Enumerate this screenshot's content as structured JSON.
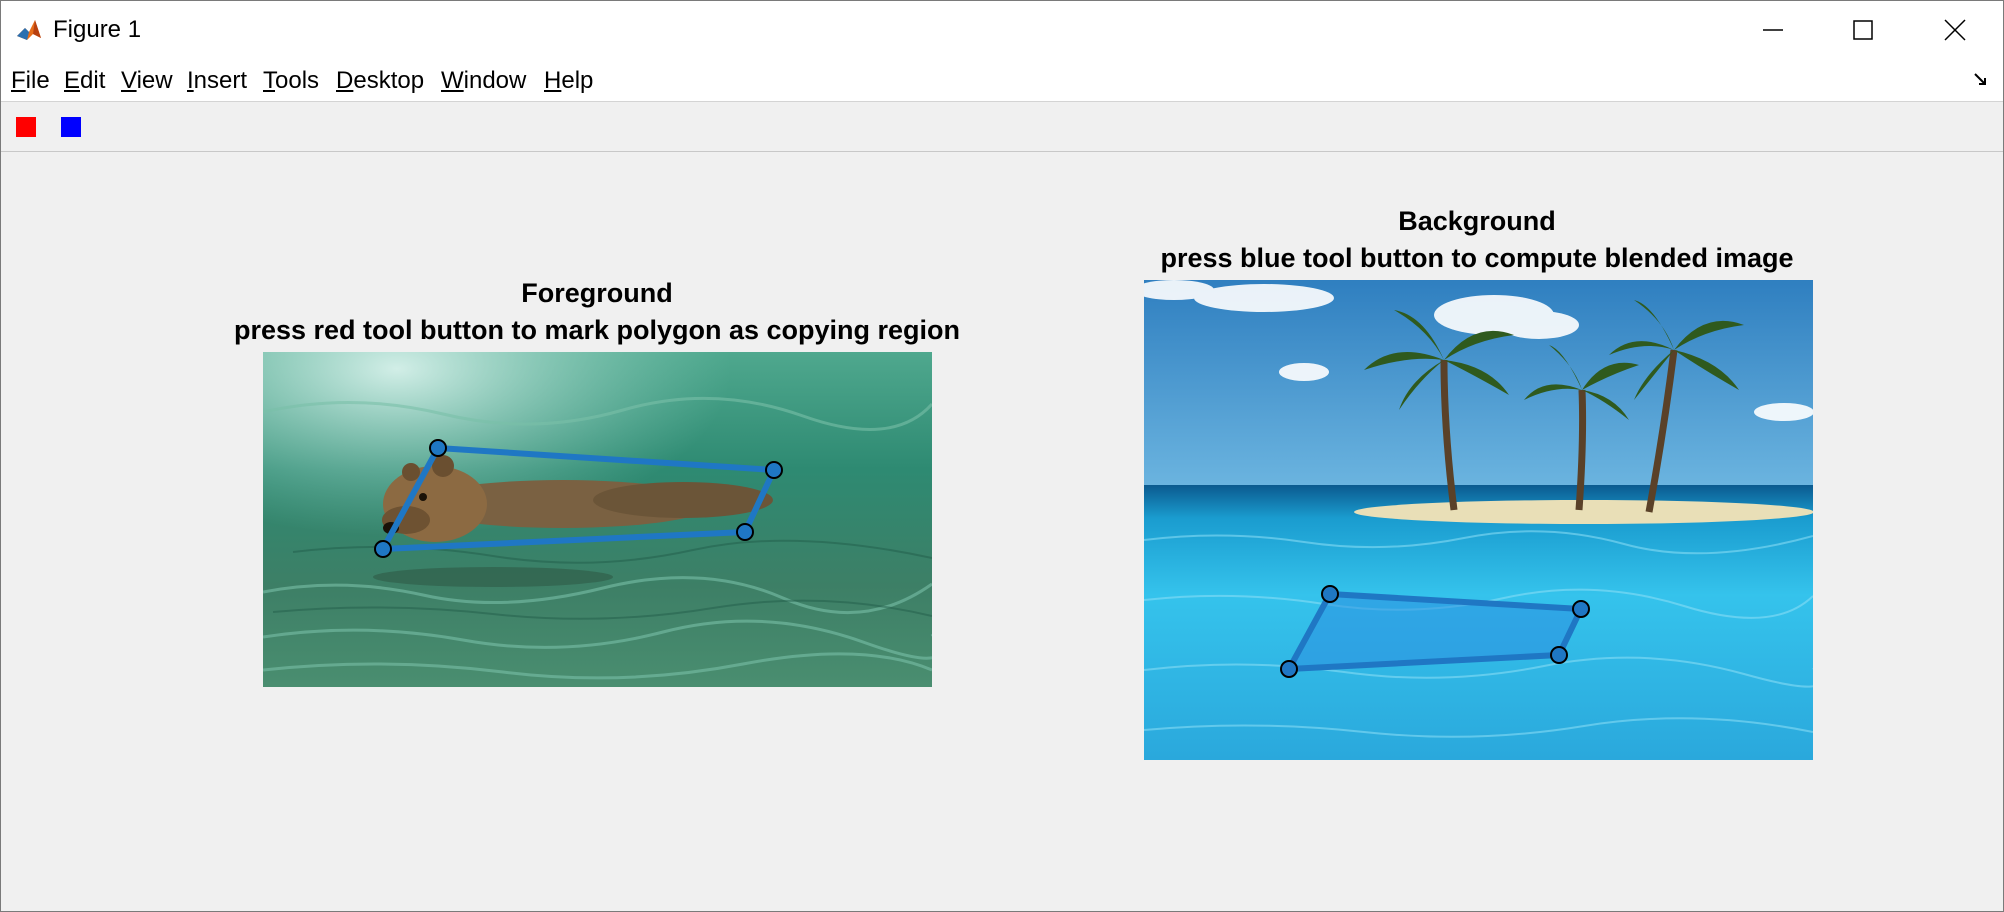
{
  "window": {
    "title": "Figure 1",
    "controls": {
      "minimize": "minimize-icon",
      "maximize": "maximize-icon",
      "close": "close-icon"
    }
  },
  "menu": [
    {
      "label": "File",
      "accel": "F"
    },
    {
      "label": "Edit",
      "accel": "E"
    },
    {
      "label": "View",
      "accel": "V"
    },
    {
      "label": "Insert",
      "accel": "I"
    },
    {
      "label": "Tools",
      "accel": "T"
    },
    {
      "label": "Desktop",
      "accel": "D"
    },
    {
      "label": "Window",
      "accel": "W"
    },
    {
      "label": "Help",
      "accel": "H"
    }
  ],
  "toolbar": {
    "buttons": [
      {
        "name": "red-tool-button",
        "color": "#ff0000",
        "icon": "red-square-icon"
      },
      {
        "name": "blue-tool-button",
        "color": "#0000ff",
        "icon": "blue-square-icon"
      }
    ]
  },
  "foreground": {
    "title": "Foreground",
    "subtitle": "press red tool button to mark polygon as copying region",
    "polygon_color": "#1f77c4"
  },
  "background": {
    "title": "Background",
    "subtitle": "press blue tool button to compute blended image",
    "polygon_color": "#1f77c4"
  }
}
